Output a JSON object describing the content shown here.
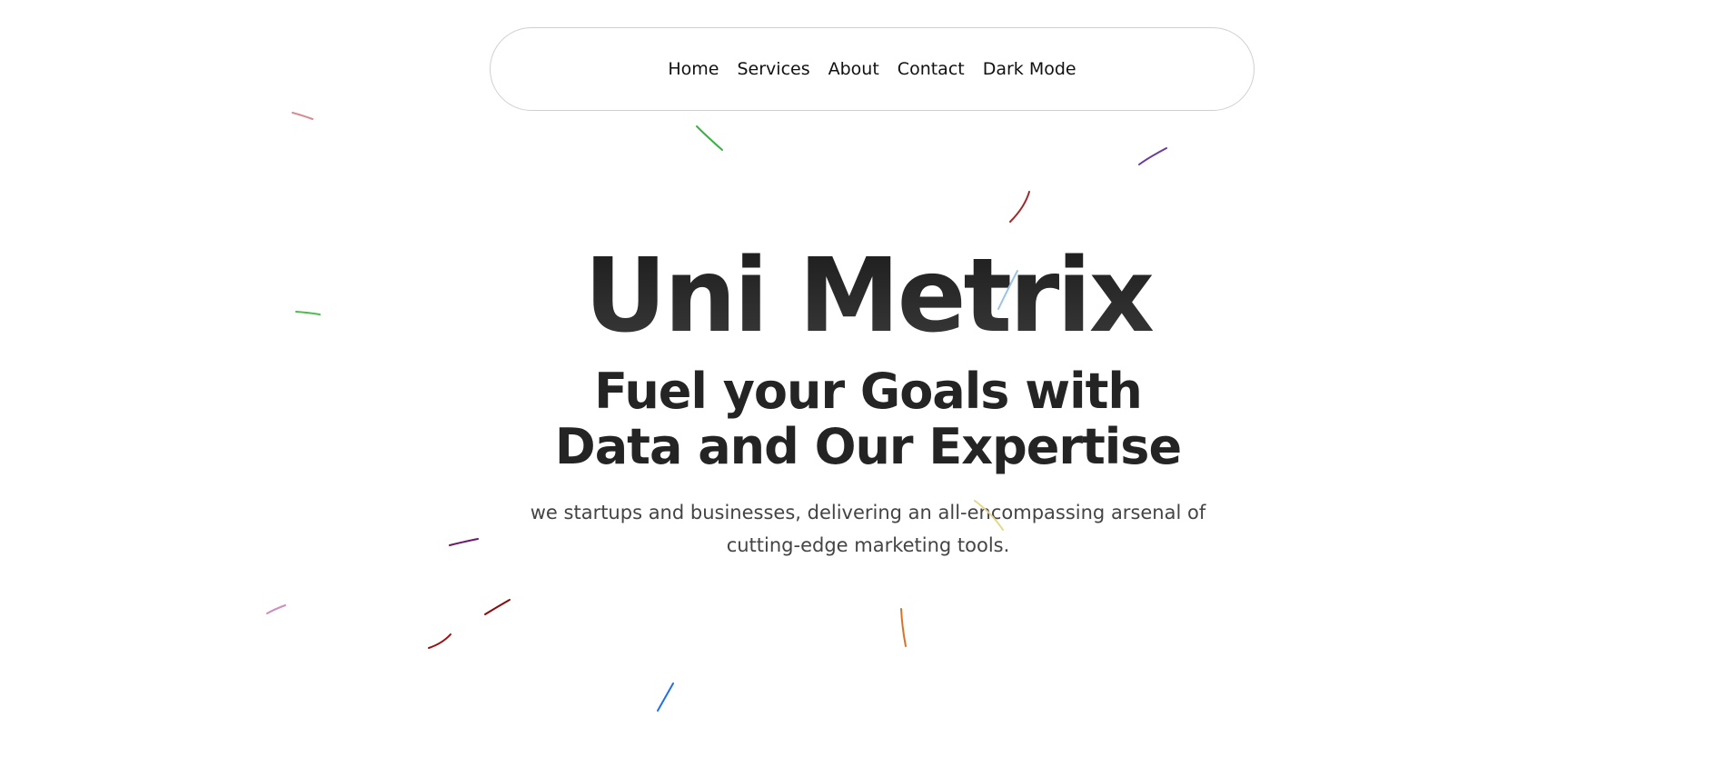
{
  "nav": {
    "items": [
      {
        "label": "Home"
      },
      {
        "label": "Services"
      },
      {
        "label": "About"
      },
      {
        "label": "Contact"
      },
      {
        "label": "Dark Mode"
      }
    ]
  },
  "hero": {
    "title": "Uni Metrix",
    "subtitle_line1": "Fuel your Goals with",
    "subtitle_line2": "Data and Our Expertise",
    "description_line1": "we startups and businesses, delivering an all-encompassing arsenal of",
    "description_line2": "cutting-edge marketing tools."
  },
  "colors": {
    "background": "#ffffff",
    "text_dark": "#242424",
    "nav_border": "#cfcfcf",
    "confetti": [
      "#d98a94",
      "#3bb043",
      "#6a3aa0",
      "#a02828",
      "#9cc3e6",
      "#e6d68a",
      "#44c044",
      "#6b1a6b",
      "#cc8fc0",
      "#8b0a0a",
      "#9c1010",
      "#e07020",
      "#1e6ff0"
    ]
  }
}
